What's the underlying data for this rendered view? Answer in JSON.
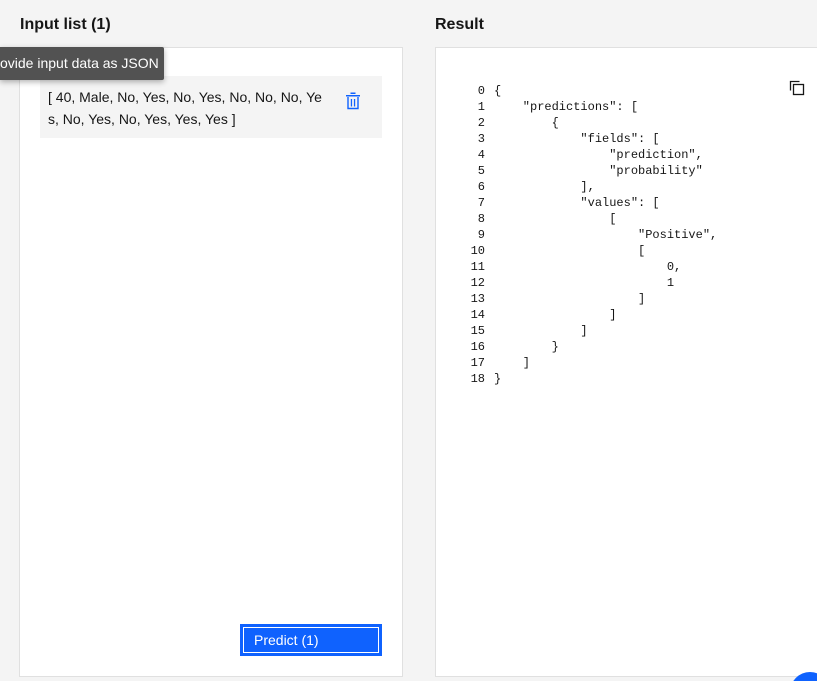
{
  "input": {
    "heading": "Input list (1)",
    "tooltip": "Provide input data as JSON",
    "item_text": "[ 40, Male, No, Yes, No, Yes, No, No, No, Yes, No, Yes, No, Yes, Yes, Yes ]",
    "delete_icon": "trash-icon",
    "predict_label": "Predict (1)"
  },
  "result": {
    "heading": "Result",
    "copy_icon": "copy-icon",
    "lines": [
      {
        "n": "0",
        "t": "{"
      },
      {
        "n": "1",
        "t": "    \"predictions\": ["
      },
      {
        "n": "2",
        "t": "        {"
      },
      {
        "n": "3",
        "t": "            \"fields\": ["
      },
      {
        "n": "4",
        "t": "                \"prediction\","
      },
      {
        "n": "5",
        "t": "                \"probability\""
      },
      {
        "n": "6",
        "t": "            ],"
      },
      {
        "n": "7",
        "t": "            \"values\": ["
      },
      {
        "n": "8",
        "t": "                ["
      },
      {
        "n": "9",
        "t": "                    \"Positive\","
      },
      {
        "n": "10",
        "t": "                    ["
      },
      {
        "n": "11",
        "t": "                        0,"
      },
      {
        "n": "12",
        "t": "                        1"
      },
      {
        "n": "13",
        "t": "                    ]"
      },
      {
        "n": "14",
        "t": "                ]"
      },
      {
        "n": "15",
        "t": "            ]"
      },
      {
        "n": "16",
        "t": "        }"
      },
      {
        "n": "17",
        "t": "    ]"
      },
      {
        "n": "18",
        "t": "}"
      }
    ]
  },
  "colors": {
    "accent": "#0f62fe",
    "tooltip_bg": "#525252",
    "background": "#f4f4f4"
  }
}
